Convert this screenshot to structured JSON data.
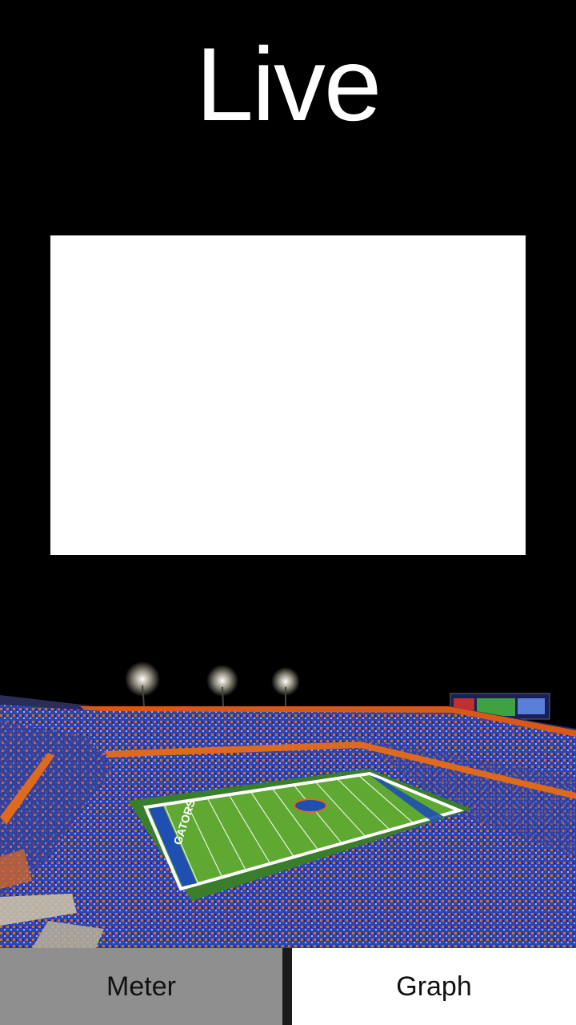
{
  "header": {
    "title": "Live"
  },
  "main": {
    "panel_color": "#ffffff"
  },
  "background_image": {
    "icon": "stadium-photo",
    "field_text": "GATORS",
    "colors": {
      "sky": "#000000",
      "field": "#5fa832",
      "crowd_blue": "#2c43b8",
      "crowd_orange": "#e06a1c"
    }
  },
  "tabs": [
    {
      "label": "Meter",
      "selected": false,
      "color": "#8f8f8f"
    },
    {
      "label": "Graph",
      "selected": true,
      "color": "#ffffff"
    }
  ]
}
